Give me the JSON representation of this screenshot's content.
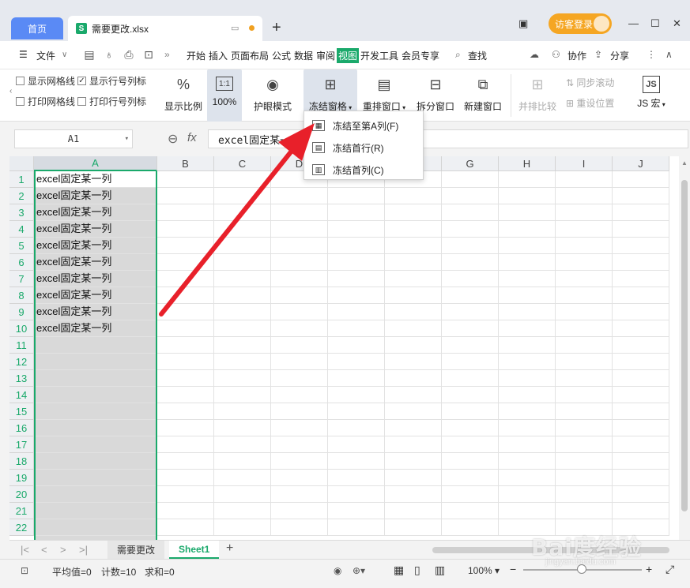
{
  "titlebar": {
    "home_tab": "首页",
    "file_tab": "需要更改.xlsx",
    "file_icon_letter": "S",
    "login_button": "访客登录"
  },
  "menu": {
    "file": "文件",
    "tabs": [
      "开始",
      "插入",
      "页面布局",
      "公式",
      "数据",
      "审阅",
      "视图",
      "开发工具",
      "会员专享"
    ],
    "active_tab": "视图",
    "search": "查找",
    "collab": "协作",
    "share": "分享"
  },
  "ribbon": {
    "checks": [
      {
        "label": "显示网格线",
        "checked": false
      },
      {
        "label": "显示行号列标",
        "checked": true
      },
      {
        "label": "打印网格线",
        "checked": false
      },
      {
        "label": "打印行号列标",
        "checked": false
      }
    ],
    "zoom_label": "显示比例",
    "zoom100_label": "100%",
    "zoom100_icon_text": "1:1",
    "eye_mode": "护眼模式",
    "freeze": "冻结窗格",
    "rearrange": "重排窗口",
    "split": "拆分窗口",
    "new_window": "新建窗口",
    "side_compare": "并排比较",
    "sync_scroll": "同步滚动",
    "reset_pos": "重设位置",
    "js_macro": "JS 宏",
    "js_icon_text": "JS"
  },
  "freeze_menu": {
    "items": [
      "冻结至第A列(F)",
      "冻结首行(R)",
      "冻结首列(C)"
    ]
  },
  "formula_bar": {
    "cell_ref": "A1",
    "fx": "fx",
    "content": "excel固定某一列"
  },
  "sheet": {
    "columns": [
      "A",
      "B",
      "C",
      "D",
      "E",
      "F",
      "G",
      "H",
      "I",
      "J"
    ],
    "rows": [
      "1",
      "2",
      "3",
      "4",
      "5",
      "6",
      "7",
      "8",
      "9",
      "10",
      "11",
      "12",
      "13",
      "14",
      "15",
      "16",
      "17",
      "18",
      "19",
      "20",
      "21",
      "22"
    ],
    "cell_text": "excel固定某一列",
    "filled_rows": 10
  },
  "tabs_bar": {
    "sheets": [
      "需要更改",
      "Sheet1"
    ],
    "active_sheet": "Sheet1"
  },
  "status": {
    "average": "平均值=0",
    "count": "计数=10",
    "sum": "求和=0",
    "zoom": "100%"
  },
  "watermark": {
    "text": "Bai度经验",
    "sub": "jingyan.baidu.com"
  },
  "colors": {
    "accent_green": "#1aa96b",
    "home_tab_blue": "#5a8af5",
    "login_orange": "#f5a623",
    "arrow_red": "#e8202a"
  }
}
